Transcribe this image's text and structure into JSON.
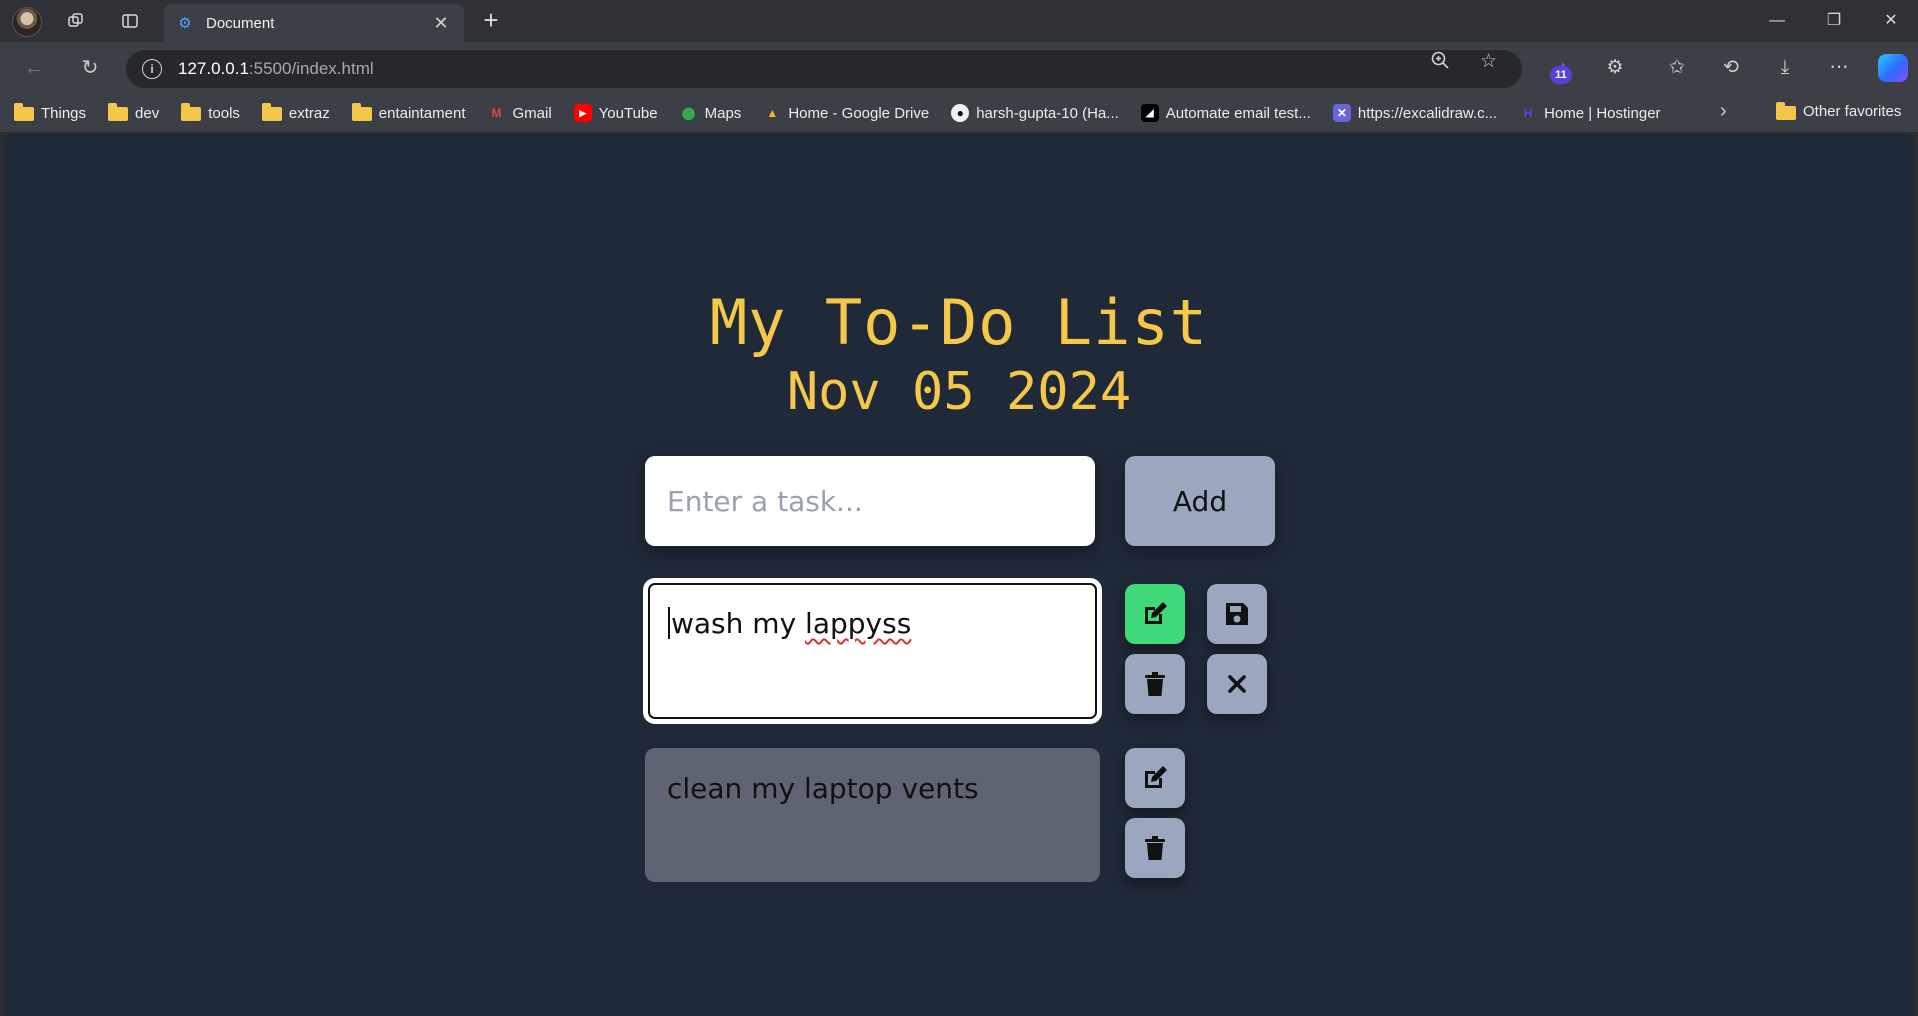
{
  "browser": {
    "tab_title": "Document",
    "url_host": "127.0.0.1",
    "url_rest": ":5500/index.html",
    "extension_badge": "11",
    "bookmarks": [
      {
        "label": "Things",
        "icon": "folder-icon"
      },
      {
        "label": "dev",
        "icon": "folder-icon"
      },
      {
        "label": "tools",
        "icon": "folder-icon"
      },
      {
        "label": "extraz",
        "icon": "folder-icon"
      },
      {
        "label": "entaintament",
        "icon": "folder-icon"
      },
      {
        "label": "Gmail",
        "icon": "gmail-icon"
      },
      {
        "label": "YouTube",
        "icon": "youtube-icon"
      },
      {
        "label": "Maps",
        "icon": "maps-icon"
      },
      {
        "label": "Home - Google Drive",
        "icon": "drive-icon"
      },
      {
        "label": "harsh-gupta-10 (Ha...",
        "icon": "github-icon"
      },
      {
        "label": "Automate email test...",
        "icon": "mailtrap-icon"
      },
      {
        "label": "https://excalidraw.c...",
        "icon": "excalidraw-icon"
      },
      {
        "label": "Home | Hostinger",
        "icon": "hostinger-icon"
      }
    ],
    "other_favorites": "Other favorites"
  },
  "app": {
    "title": "My To-Do List",
    "date": "Nov 05 2024",
    "input_placeholder": "Enter a task...",
    "add_label": "Add",
    "editing_task": {
      "text_prefix": "wash my ",
      "text_misspelled": "lappyss"
    },
    "tasks": [
      {
        "text": "clean my laptop vents"
      }
    ]
  },
  "colors": {
    "page_bg": "#202938",
    "title": "#f5c84a",
    "button": "#9aa7bf",
    "edit_active": "#3fd97a",
    "task_bg": "#5e6472"
  }
}
